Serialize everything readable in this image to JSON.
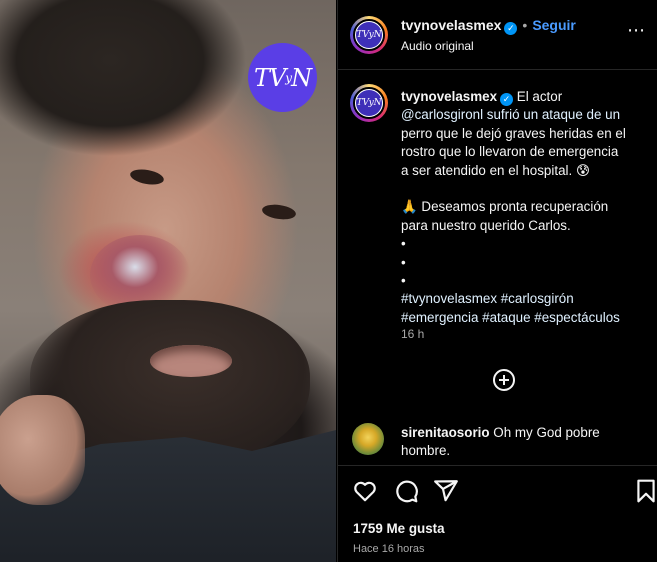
{
  "media": {
    "watermark": {
      "main": "TV",
      "small": "y",
      "tail": "N"
    }
  },
  "header": {
    "username": "tvynovelasmex",
    "separator": "•",
    "follow_label": "Seguir",
    "audio_label": "Audio original",
    "more_label": "⋯",
    "avatar_text": "TVyN"
  },
  "caption": {
    "username": "tvynovelasmex",
    "lines": [
      "El actor",
      "@carlosgironl sufrió un ataque de un",
      "perro que le dejó graves heridas en el",
      "rostro que lo llevaron de emergencia",
      "a ser atendido en el hospital. 😰",
      "",
      "🙏 Deseamos pronta recuperación",
      "para nuestro querido Carlos.",
      "•",
      "•",
      "•",
      "#tvynovelasmex #carlosgirón",
      "#emergencia #ataque #espectáculos"
    ],
    "age": "16 h"
  },
  "comments": [
    {
      "username": "sirenitaosorio",
      "text": "Oh my God pobre hombre."
    }
  ],
  "actions": {
    "likes": "1759 Me gusta",
    "timestamp": "Hace 16 horas"
  },
  "colors": {
    "follow": "#4a9bff",
    "verified": "#0095f6",
    "logo": "#5a3ee6",
    "background": "#000000",
    "muted": "#a8a8a8"
  }
}
